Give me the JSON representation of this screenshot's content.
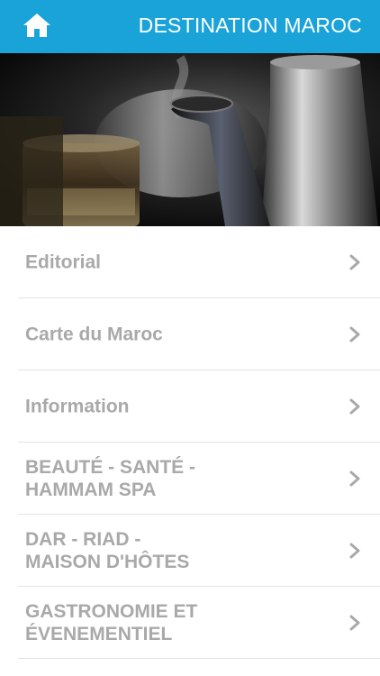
{
  "header": {
    "title": "DESTINATION MAROC",
    "home_icon": "home-icon",
    "background": "#1aa3d9"
  },
  "hero": {
    "image": "moroccan-teapot-and-tea-glasses-photo"
  },
  "menu": {
    "items": [
      {
        "label": "Editorial",
        "icon": "chevron-right-icon"
      },
      {
        "label": "Carte du Maroc",
        "icon": "chevron-right-icon"
      },
      {
        "label": "Information",
        "icon": "chevron-right-icon"
      },
      {
        "label": "BEAUTÉ - SANTÉ -\nHAMMAM SPA",
        "icon": "chevron-right-icon"
      },
      {
        "label": "DAR - RIAD -\nMAISON D'HÔTES",
        "icon": "chevron-right-icon"
      },
      {
        "label": "GASTRONOMIE ET\nÉVENEMENTIEL",
        "icon": "chevron-right-icon"
      }
    ]
  },
  "colors": {
    "accent": "#1aa3d9",
    "menu_text": "#a9a9a9",
    "divider": "#e4e4e4"
  }
}
